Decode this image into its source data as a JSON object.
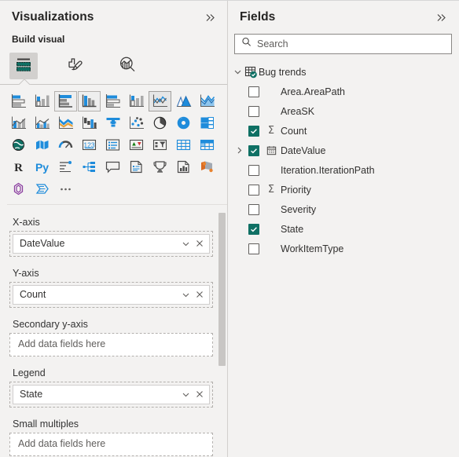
{
  "visualizations": {
    "title": "Visualizations",
    "collapse_icon": "chevron-double-right-icon",
    "build_visual_label": "Build visual",
    "tabs": [
      {
        "name": "build-visual",
        "label": "Build visual",
        "icon": "build-visual-icon",
        "selected": true
      },
      {
        "name": "format-visual",
        "label": "Format visual",
        "icon": "format-paintbrush-icon",
        "selected": false
      },
      {
        "name": "analytics",
        "label": "Analytics",
        "icon": "analytics-magnifier-icon",
        "selected": false
      }
    ],
    "gallery": {
      "rows": [
        [
          {
            "name": "stacked-bar-chart",
            "label": "Stacked bar chart",
            "state": "normal"
          },
          {
            "name": "stacked-column-chart",
            "label": "Stacked column chart",
            "state": "normal"
          },
          {
            "name": "clustered-bar-chart",
            "label": "Clustered bar chart",
            "state": "frame"
          },
          {
            "name": "clustered-column-chart",
            "label": "Clustered column chart",
            "state": "frame"
          },
          {
            "name": "hundred-percent-stacked-bar-chart",
            "label": "100% Stacked bar chart",
            "state": "normal"
          },
          {
            "name": "hundred-percent-stacked-column-chart",
            "label": "100% Stacked column chart",
            "state": "normal"
          },
          {
            "name": "line-chart",
            "label": "Line chart",
            "state": "selected"
          },
          {
            "name": "area-chart",
            "label": "Area chart",
            "state": "normal"
          },
          {
            "name": "stacked-area-chart",
            "label": "Stacked area chart",
            "state": "normal"
          }
        ],
        [
          {
            "name": "line-and-stacked-column-chart",
            "label": "Line and stacked column chart",
            "state": "normal"
          },
          {
            "name": "line-and-clustered-column-chart",
            "label": "Line and clustered column chart",
            "state": "normal"
          },
          {
            "name": "ribbon-chart",
            "label": "Ribbon chart",
            "state": "normal"
          },
          {
            "name": "waterfall-chart",
            "label": "Waterfall chart",
            "state": "normal"
          },
          {
            "name": "funnel-chart",
            "label": "Funnel",
            "state": "normal"
          },
          {
            "name": "scatter-chart",
            "label": "Scatter chart",
            "state": "normal"
          },
          {
            "name": "pie-chart",
            "label": "Pie chart",
            "state": "normal"
          },
          {
            "name": "donut-chart",
            "label": "Donut chart",
            "state": "normal"
          },
          {
            "name": "treemap",
            "label": "Treemap",
            "state": "normal"
          }
        ],
        [
          {
            "name": "map",
            "label": "Map",
            "state": "normal"
          },
          {
            "name": "filled-map",
            "label": "Filled map",
            "state": "normal"
          },
          {
            "name": "gauge",
            "label": "Gauge",
            "state": "normal"
          },
          {
            "name": "card",
            "label": "Card",
            "state": "normal"
          },
          {
            "name": "multi-row-card",
            "label": "Multi-row card",
            "state": "normal"
          },
          {
            "name": "kpi",
            "label": "KPI",
            "state": "normal"
          },
          {
            "name": "slicer",
            "label": "Slicer",
            "state": "normal"
          },
          {
            "name": "table",
            "label": "Table",
            "state": "normal"
          },
          {
            "name": "matrix",
            "label": "Matrix",
            "state": "normal"
          }
        ],
        [
          {
            "name": "r-script-visual",
            "label": "R script visual",
            "state": "normal"
          },
          {
            "name": "python-visual",
            "label": "Python visual",
            "state": "normal"
          },
          {
            "name": "key-influencers",
            "label": "Key influencers",
            "state": "normal"
          },
          {
            "name": "decomposition-tree",
            "label": "Decomposition tree",
            "state": "normal"
          },
          {
            "name": "qna-visual",
            "label": "Q&A",
            "state": "normal"
          },
          {
            "name": "smart-narrative",
            "label": "Smart narrative",
            "state": "normal"
          },
          {
            "name": "metrics-visual",
            "label": "Metrics",
            "state": "normal"
          },
          {
            "name": "paginated-report",
            "label": "Paginated report",
            "state": "normal"
          },
          {
            "name": "power-apps-visual",
            "label": "Power Apps for Power BI",
            "state": "normal"
          }
        ],
        [
          {
            "name": "azure-map",
            "label": "Azure Map",
            "state": "normal"
          },
          {
            "name": "arcgis-maps",
            "label": "ArcGIS Maps for Power BI",
            "state": "normal"
          },
          {
            "name": "more-visuals",
            "label": "More options",
            "state": "normal"
          }
        ]
      ]
    },
    "wells": [
      {
        "name": "x-axis",
        "label": "X-axis",
        "field": "DateValue",
        "empty_placeholder": null
      },
      {
        "name": "y-axis",
        "label": "Y-axis",
        "field": "Count",
        "empty_placeholder": null
      },
      {
        "name": "secondary-y-axis",
        "label": "Secondary y-axis",
        "field": null,
        "empty_placeholder": "Add data fields here"
      },
      {
        "name": "legend",
        "label": "Legend",
        "field": "State",
        "empty_placeholder": null
      },
      {
        "name": "small-multiples",
        "label": "Small multiples",
        "field": null,
        "empty_placeholder": "Add data fields here"
      }
    ],
    "chip_icons": {
      "menu": "chevron-down-icon",
      "remove": "close-x-icon"
    }
  },
  "fields": {
    "title": "Fields",
    "collapse_icon": "chevron-double-right-icon",
    "search": {
      "placeholder": "Search",
      "value": "",
      "icon": "search-icon"
    },
    "tables": [
      {
        "name": "bug-trends",
        "label": "Bug trends",
        "expanded": true,
        "expand_icon": "chevron-down-icon",
        "icon": "table-checked-icon",
        "items": [
          {
            "name": "area-areapath",
            "label": "Area.AreaPath",
            "checked": false,
            "expandable": false,
            "icon": null
          },
          {
            "name": "areask",
            "label": "AreaSK",
            "checked": false,
            "expandable": false,
            "icon": null
          },
          {
            "name": "count",
            "label": "Count",
            "checked": true,
            "expandable": false,
            "icon": "sigma-icon"
          },
          {
            "name": "datevalue",
            "label": "DateValue",
            "checked": true,
            "expandable": true,
            "icon": "calendar-icon"
          },
          {
            "name": "iteration-iterationpath",
            "label": "Iteration.IterationPath",
            "checked": false,
            "expandable": false,
            "icon": null
          },
          {
            "name": "priority",
            "label": "Priority",
            "checked": false,
            "expandable": false,
            "icon": "sigma-icon"
          },
          {
            "name": "severity",
            "label": "Severity",
            "checked": false,
            "expandable": false,
            "icon": null
          },
          {
            "name": "state",
            "label": "State",
            "checked": true,
            "expandable": false,
            "icon": null
          },
          {
            "name": "workitemtype",
            "label": "WorkItemType",
            "checked": false,
            "expandable": false,
            "icon": null
          }
        ]
      }
    ]
  },
  "colors": {
    "pane_background": "#f3f2f1",
    "accent_green": "#0f7064",
    "chart_blue": "#1f8cdb",
    "chart_gray": "#a9a9a9",
    "text_primary": "#252423",
    "text_secondary": "#605e5c",
    "border": "#c8c6c4"
  }
}
